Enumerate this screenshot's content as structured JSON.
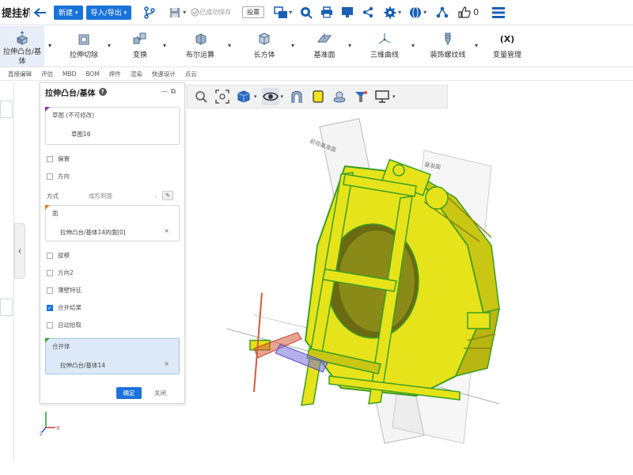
{
  "app": {
    "title": "提挂机"
  },
  "topbar": {
    "new_label": "新建",
    "import_export_label": "导入/导出",
    "saved_status": "已成功保存",
    "invest_label": "投票",
    "like_count": "0",
    "icons": [
      "back-arrow-icon",
      "branch-icon",
      "save-icon",
      "check-circle-icon",
      "display-icon",
      "search-icon",
      "print-icon",
      "monitor-icon",
      "share-icon",
      "gear-icon",
      "globe-icon",
      "network-icon",
      "thumbs-up-icon",
      "menu-icon"
    ]
  },
  "ribbon": {
    "items": [
      {
        "label": "拉伸凸台/基体",
        "icon": "extrude-boss-icon"
      },
      {
        "label": "拉伸切除",
        "icon": "extrude-cut-icon"
      },
      {
        "label": "变换",
        "icon": "transform-icon"
      },
      {
        "label": "布尔运算",
        "icon": "boolean-icon"
      },
      {
        "label": "长方体",
        "icon": "box-icon"
      },
      {
        "label": "基准面",
        "icon": "datum-plane-icon"
      },
      {
        "label": "三维曲线",
        "icon": "3d-curve-icon"
      },
      {
        "label": "装饰螺纹线",
        "icon": "thread-icon"
      },
      {
        "label": "变量管理",
        "icon": "variable-icon",
        "glyph": "(X)"
      }
    ],
    "tabs": [
      "直接编辑",
      "评估",
      "MBD",
      "BOM",
      "焊件",
      "渲染",
      "快速设计",
      "点云"
    ]
  },
  "panel": {
    "title": "拉伸凸台/基体",
    "sketch_section_title": "草图 (不可修改)",
    "sketch_value": "草图16",
    "offset_label": "偏置",
    "direction_label": "方向",
    "method_label": "方式",
    "method_value": "成形到面",
    "face_section_title": "面",
    "face_value": "拉伸凸台/基体14的面[0]",
    "draft_label": "拔模",
    "direction2_label": "方向2",
    "thin_label": "薄壁特征",
    "merge_result_label": "合并结果",
    "auto_select_label": "自动拾取",
    "merge_body_title": "合并体",
    "merge_body_value": "拉伸凸台/基体14",
    "ok_label": "确定",
    "close_label": "关闭",
    "merge_result_checked": true
  },
  "viewport": {
    "plane_label_1": "前视基准面",
    "plane_label_2": "基准面",
    "model_color": "#e6e31a",
    "edge_color": "#3a9e23",
    "axis_x": "X",
    "axis_z": "Z"
  },
  "colors": {
    "accent": "#1a73d9",
    "toolbar_bg": "#f2f2f2"
  }
}
